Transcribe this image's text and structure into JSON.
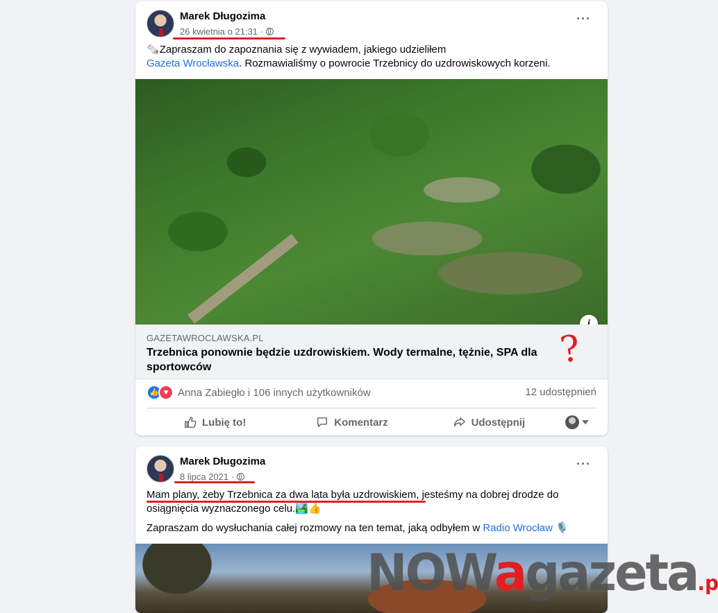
{
  "posts": [
    {
      "author": "Marek Długozima",
      "timestamp": "26 kwietnia o 21:31",
      "meta_separator": "·",
      "text_emoji": "🗞️",
      "text_line1": "Zapraszam do zapoznania się z wywiadem, jakiego udzieliłem",
      "text_link": "Gazeta Wrocławska",
      "text_line2": ". Rozmawialiśmy o powrocie Trzebnicy do uzdrowiskowych korzeni.",
      "link_domain": "GAZETAWROCLAWSKA.PL",
      "link_headline": "Trzebnica ponownie będzie uzdrowiskiem. Wody termalne, tężnie, SPA dla sportowców",
      "annotation_mark": "?",
      "reactions_text": "Anna Zabiegło i 106 innych użytkowników",
      "shares_text": "12 udostępnień",
      "actions": {
        "like": "Lubię to!",
        "comment": "Komentarz",
        "share": "Udostępnij"
      }
    },
    {
      "author": "Marek Długozima",
      "timestamp": "8 lipca 2021",
      "meta_separator": "·",
      "text_highlight": "Mam plany, żeby Trzebnica za dwa lata była uzdrowiskiem",
      "text_rest": ", jesteśmy na dobrej drodze do osiągnięcia wyznaczonego celu.🏞️👍",
      "text_line2": "Zapraszam do wysłuchania całej rozmowy na ten temat, jaką odbyłem w",
      "text_link": "Radio Wrocław",
      "text_emoji": "🎙️"
    }
  ],
  "watermark": {
    "part1": "NOW",
    "part2": "a",
    "part3": "gazeta",
    "part4": ".pl"
  },
  "colors": {
    "accent": "#e02020",
    "link": "#216fdb",
    "background": "#f0f2f5"
  }
}
